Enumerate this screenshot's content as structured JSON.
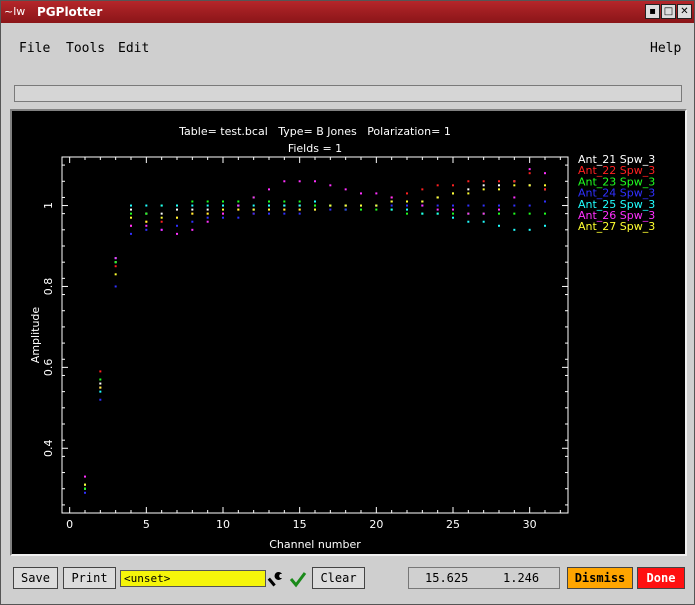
{
  "window": {
    "title": "PGPlotter",
    "icon_text": "~lw"
  },
  "menu": {
    "file": "File",
    "tools": "Tools",
    "edit": "Edit",
    "help": "Help"
  },
  "plot": {
    "title_line1": "Table= test.bcal   Type= B Jones   Polarization= 1",
    "title_line2": "Fields = 1",
    "xlabel": "Channel number",
    "ylabel": "Amplitude",
    "xticks": [
      "0",
      "5",
      "10",
      "15",
      "20",
      "25",
      "30"
    ],
    "yticks": [
      "0.4",
      "0.6",
      "0.8",
      "1"
    ]
  },
  "chart_data": {
    "type": "scatter",
    "title": "Table= test.bcal   Type= B Jones   Polarization= 1 / Fields = 1",
    "xlabel": "Channel number",
    "ylabel": "Amplitude",
    "xlim": [
      -0.5,
      32.5
    ],
    "ylim": [
      0.24,
      1.12
    ],
    "legend_position": "right",
    "x": [
      1,
      2,
      3,
      4,
      5,
      6,
      7,
      8,
      9,
      10,
      11,
      12,
      13,
      14,
      15,
      16,
      17,
      18,
      19,
      20,
      21,
      22,
      23,
      24,
      25,
      26,
      27,
      28,
      29,
      30,
      31
    ],
    "series": [
      {
        "name": "Ant_21 Spw_3",
        "color": "#ffffff",
        "values": [
          0.3,
          0.56,
          0.86,
          0.99,
          0.98,
          0.98,
          0.99,
          0.99,
          0.99,
          1.0,
          1.0,
          0.99,
          1.0,
          1.0,
          1.0,
          1.0,
          1.0,
          1.0,
          1.0,
          1.0,
          1.01,
          1.01,
          1.01,
          1.02,
          1.03,
          1.04,
          1.05,
          1.05,
          1.06,
          1.05,
          1.04
        ]
      },
      {
        "name": "Ant_22 Spw_3",
        "color": "#ff2020",
        "values": [
          0.31,
          0.59,
          0.85,
          0.95,
          0.96,
          0.96,
          0.97,
          0.98,
          0.98,
          0.98,
          0.99,
          0.98,
          0.99,
          0.99,
          0.99,
          0.99,
          1.0,
          1.0,
          1.0,
          1.0,
          1.02,
          1.03,
          1.04,
          1.05,
          1.05,
          1.06,
          1.06,
          1.06,
          1.06,
          1.08,
          1.04
        ]
      },
      {
        "name": "Ant_23 Spw_3",
        "color": "#20ff20",
        "values": [
          0.3,
          0.57,
          0.86,
          0.98,
          0.98,
          1.0,
          1.0,
          1.01,
          1.01,
          1.01,
          1.01,
          1.02,
          1.01,
          1.01,
          1.01,
          1.0,
          1.0,
          0.99,
          0.99,
          0.99,
          0.99,
          0.98,
          0.98,
          0.98,
          0.98,
          0.98,
          0.98,
          0.98,
          0.98,
          0.98,
          0.98
        ]
      },
      {
        "name": "Ant_24 Spw_3",
        "color": "#3030ff",
        "values": [
          0.29,
          0.52,
          0.8,
          0.93,
          0.94,
          0.94,
          0.95,
          0.96,
          0.97,
          0.97,
          0.97,
          0.98,
          0.98,
          0.98,
          0.98,
          0.99,
          0.99,
          0.99,
          1.0,
          1.0,
          1.0,
          1.0,
          1.0,
          1.0,
          1.0,
          1.0,
          1.0,
          1.0,
          1.0,
          1.0,
          1.01
        ]
      },
      {
        "name": "Ant_25 Spw_3",
        "color": "#20ffff",
        "values": [
          0.31,
          0.54,
          0.87,
          1.0,
          1.0,
          1.0,
          1.0,
          1.0,
          1.0,
          1.0,
          1.0,
          1.0,
          1.0,
          1.0,
          1.0,
          1.01,
          1.0,
          1.0,
          1.0,
          1.0,
          0.99,
          0.99,
          0.98,
          0.98,
          0.97,
          0.96,
          0.96,
          0.95,
          0.94,
          0.94,
          0.95
        ]
      },
      {
        "name": "Ant_26 Spw_3",
        "color": "#ff30ff",
        "values": [
          0.33,
          0.55,
          0.87,
          0.95,
          0.95,
          0.94,
          0.93,
          0.94,
          0.96,
          0.98,
          1.0,
          1.02,
          1.04,
          1.06,
          1.06,
          1.06,
          1.05,
          1.04,
          1.03,
          1.03,
          1.02,
          1.01,
          1.0,
          0.99,
          0.99,
          0.98,
          0.98,
          0.99,
          1.02,
          1.09,
          1.08
        ]
      },
      {
        "name": "Ant_27 Spw_3",
        "color": "#ffff30",
        "values": [
          0.31,
          0.55,
          0.83,
          0.97,
          0.96,
          0.97,
          0.97,
          0.98,
          0.98,
          0.99,
          0.99,
          0.99,
          0.99,
          0.99,
          0.99,
          0.99,
          1.0,
          1.0,
          1.0,
          1.0,
          1.01,
          1.01,
          1.01,
          1.02,
          1.03,
          1.03,
          1.04,
          1.04,
          1.05,
          1.05,
          1.05
        ]
      }
    ]
  },
  "toolbar": {
    "save": "Save",
    "print": "Print",
    "entry_value": "<unset>",
    "clear": "Clear",
    "coord_x": "15.625",
    "coord_y": "1.246",
    "dismiss": "Dismiss",
    "done": "Done",
    "dismiss_color": "#ffa500",
    "done_color": "#ff1010"
  }
}
